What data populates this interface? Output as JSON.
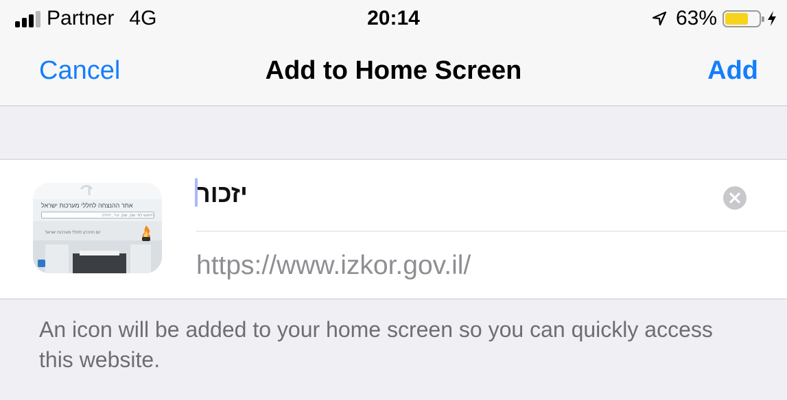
{
  "status_bar": {
    "carrier": "Partner",
    "network": "4G",
    "time": "20:14",
    "battery": "63%",
    "battery_level": 0.63,
    "signal_bars_active": 3,
    "icons": [
      "signal-bars-icon",
      "location-arrow-icon",
      "battery-icon",
      "charging-bolt-icon"
    ]
  },
  "nav": {
    "cancel_label": "Cancel",
    "title": "Add to Home Screen",
    "add_label": "Add"
  },
  "form": {
    "name_value": "יזכור",
    "url": "https://www.izkor.gov.il/",
    "thumbnail_heading": "אתר ההנצחה לחללי מערכות ישראל",
    "thumbnail_search": "חיפוש לפי שם, שם, עיר, יחידה",
    "thumbnail_subtext": "יום הזיכרון לחללי מערכות ישראל",
    "clear_icon": "clear-text-icon"
  },
  "footer": {
    "text": "An icon will be added to your home screen so you can quickly access this website."
  },
  "colors": {
    "accent": "#147efb",
    "background": "#efeff4",
    "panel": "#ffffff",
    "secondary_text": "#8e8e93",
    "battery": "#f8d31c"
  }
}
